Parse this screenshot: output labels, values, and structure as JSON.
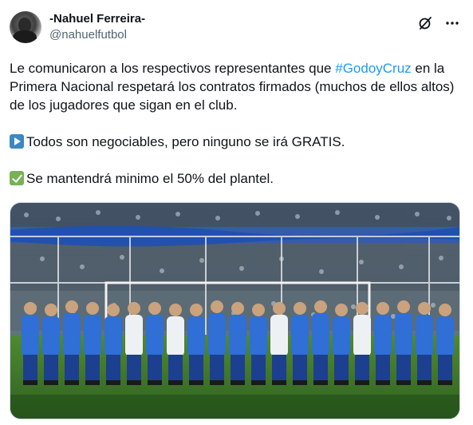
{
  "author": {
    "display_name": "-Nahuel Ferreira-",
    "handle": "@nahuelfutbol"
  },
  "tweet": {
    "line1_before": "Le comunicaron a los respectivos representantes que ",
    "hashtag": "#GodoyCruz",
    "line1_after": " en la Primera Nacional respetará los contratos firmados (muchos de ellos altos) de los jugadores que sigan en el club.",
    "point1": "Todos son negociables, pero ninguno se irá GRATIS.",
    "point2": "Se mantendrá minimo el 50% del plantel."
  },
  "icons": {
    "grok": "grok-icon",
    "more": "more-icon",
    "play_emoji": "play-button-emoji-icon",
    "check_emoji": "check-mark-emoji-icon"
  },
  "colors": {
    "link": "#1d9bf0",
    "secondary_text": "#536471",
    "primary_text": "#0f1419"
  }
}
